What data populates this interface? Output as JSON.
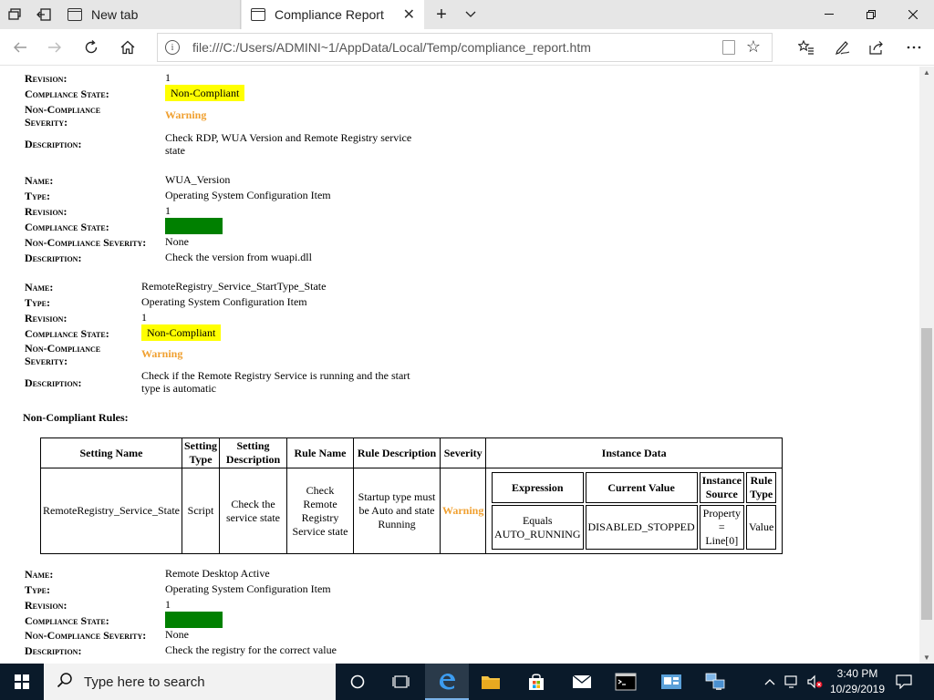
{
  "browser": {
    "tabs": [
      {
        "label": "New tab"
      },
      {
        "label": "Compliance Report"
      }
    ],
    "url": "file:///C:/Users/ADMINI~1/AppData/Local/Temp/compliance_report.htm"
  },
  "labels": {
    "name": "Name:",
    "type": "Type:",
    "revision": "Revision:",
    "compliance_state": "Compliance State:",
    "non_compliance_severity": "Non-Compliance Severity:",
    "non_compliance_severity_l1": "Non-Compliance",
    "non_compliance_severity_l2": "Severity:",
    "description": "Description:"
  },
  "items": [
    {
      "revision": "1",
      "compliance_state": "Non-Compliant",
      "severity": "Warning",
      "description": "Check RDP, WUA Version and Remote Registry service state"
    },
    {
      "name": "WUA_Version",
      "type": "Operating System Configuration Item",
      "revision": "1",
      "compliance_state": "Compliant",
      "severity": "None",
      "description": "Check the version from wuapi.dll"
    },
    {
      "name": "RemoteRegistry_Service_StartType_State",
      "type": "Operating System Configuration Item",
      "revision": "1",
      "compliance_state": "Non-Compliant",
      "severity": "Warning",
      "description": "Check if the Remote Registry Service is running and the start type is automatic"
    },
    {
      "name": "Remote Desktop Active",
      "type": "Operating System Configuration Item",
      "revision": "1",
      "compliance_state": "Compliant",
      "severity": "None",
      "description": "Check the registry for the correct value"
    }
  ],
  "non_compliant_rules": {
    "title": "Non-Compliant Rules:",
    "headers": [
      "Setting Name",
      "Setting Type",
      "Setting Description",
      "Rule Name",
      "Rule Description",
      "Severity",
      "Instance Data"
    ],
    "row": {
      "setting_name": "RemoteRegistry_Service_State",
      "setting_type": "Script",
      "setting_description": "Check the service state",
      "rule_name": "Check Remote Registry Service state",
      "rule_description": "Startup type must be Auto and state Running",
      "severity": "Warning"
    },
    "instance_headers": [
      "Expression",
      "Current Value",
      "Instance Source",
      "Rule Type"
    ],
    "instance_row": {
      "expression": "Equals AUTO_RUNNING",
      "current_value": "DISABLED_STOPPED",
      "instance_source": "Property = Line[0]",
      "rule_type": "Value"
    }
  },
  "taskbar": {
    "search_placeholder": "Type here to search",
    "time": "3:40 PM",
    "date": "10/29/2019"
  },
  "colors": {
    "non_compliant_bg": "#ffff00",
    "compliant_bg": "#008000",
    "warning_text": "#f0a030"
  }
}
